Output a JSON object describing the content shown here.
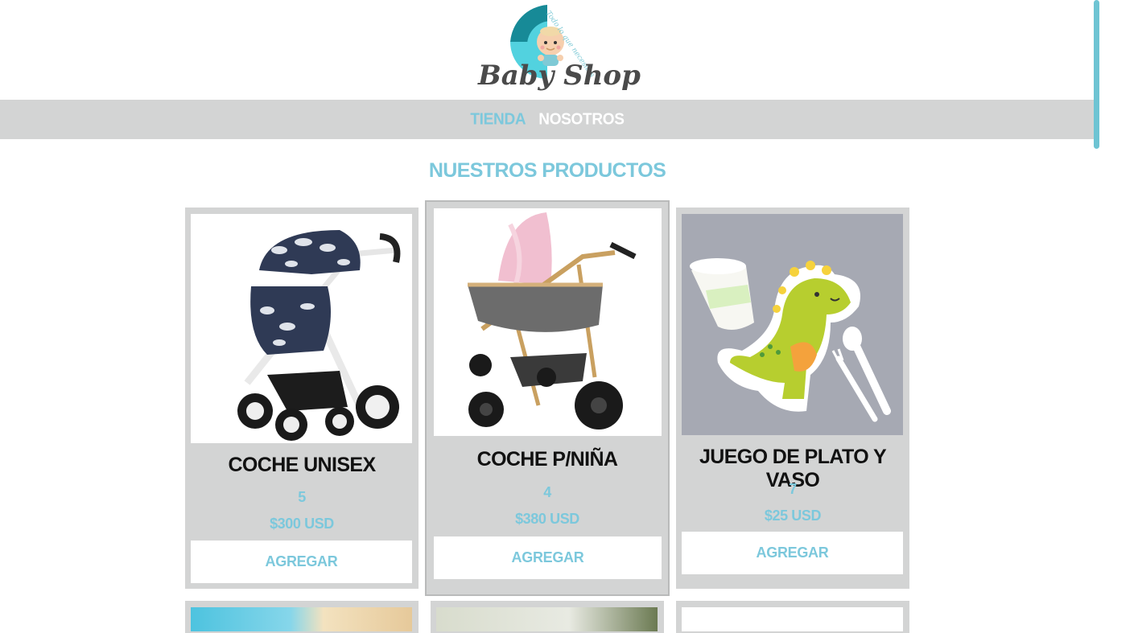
{
  "brand": {
    "name": "Baby Shop",
    "tagline": "Todo lo que necesitas"
  },
  "nav": {
    "items": [
      {
        "label": "TIENDA"
      },
      {
        "label": "NOSOTROS"
      }
    ]
  },
  "section_title": "NUESTROS PRODUCTOS",
  "colors": {
    "accent": "#7cc8dc",
    "nav_bg": "#d3d4d4",
    "card_bg": "#d3d4d4",
    "scrollbar": "#6ec4d3"
  },
  "products": [
    {
      "name": "COCHE UNISEX",
      "stock": "5",
      "price": "$300 USD",
      "button": "AGREGAR",
      "image": "stroller-unisex-image"
    },
    {
      "name": "COCHE P/NIÑA",
      "stock": "4",
      "price": "$380 USD",
      "button": "AGREGAR",
      "image": "stroller-girl-image"
    },
    {
      "name": "JUEGO DE PLATO Y VASO",
      "stock": "7",
      "price": "$25 USD",
      "button": "AGREGAR",
      "image": "dino-plate-set-image"
    }
  ]
}
